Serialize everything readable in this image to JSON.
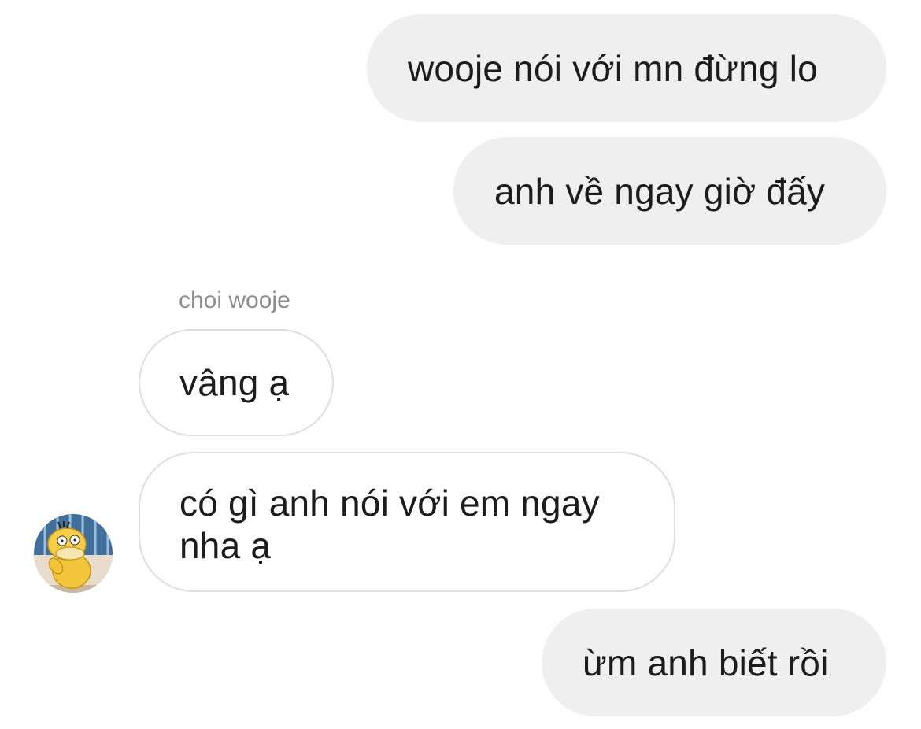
{
  "conversation": {
    "messages": [
      {
        "sender": "me",
        "text": "wooje nói với mn đừng lo"
      },
      {
        "sender": "me",
        "text": "anh về ngay giờ đấy"
      },
      {
        "sender": "choi wooje",
        "text": "vâng ạ"
      },
      {
        "sender": "choi wooje",
        "text": "có gì anh nói với em ngay nha ạ"
      },
      {
        "sender": "me",
        "text": "ừm anh biết rồi"
      }
    ],
    "sender_name": "choi wooje",
    "avatar_icon": "psyduck-avatar",
    "colors": {
      "outgoing_bubble": "#efefef",
      "incoming_border": "#dedede",
      "sender_name": "#8e8e8e",
      "text": "#1c1c1c"
    }
  }
}
